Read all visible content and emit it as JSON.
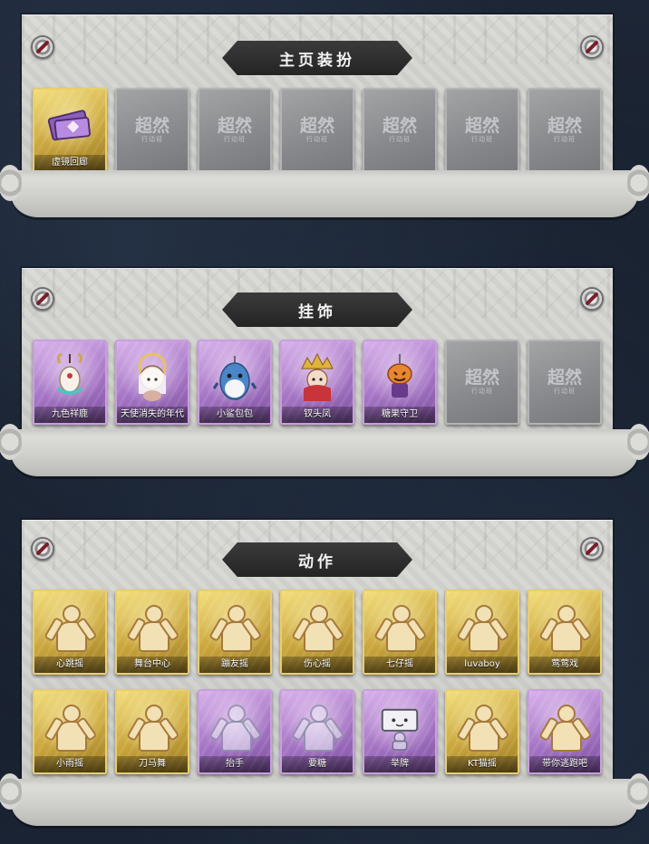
{
  "sections": [
    {
      "title": "主页装扮",
      "items": [
        {
          "label": "虚镜回廊",
          "rarity": "gold",
          "icon": "ticket-icon"
        },
        {
          "label": "",
          "rarity": "empty",
          "icon": "empty-slot-logo"
        },
        {
          "label": "",
          "rarity": "empty",
          "icon": "empty-slot-logo"
        },
        {
          "label": "",
          "rarity": "empty",
          "icon": "empty-slot-logo"
        },
        {
          "label": "",
          "rarity": "empty",
          "icon": "empty-slot-logo"
        },
        {
          "label": "",
          "rarity": "empty",
          "icon": "empty-slot-logo"
        },
        {
          "label": "",
          "rarity": "empty",
          "icon": "empty-slot-logo"
        }
      ]
    },
    {
      "title": "挂饰",
      "items": [
        {
          "label": "九色祥鹿",
          "rarity": "purple",
          "icon": "deer-charm-icon"
        },
        {
          "label": "天使消失的年代",
          "rarity": "purple",
          "icon": "angel-charm-icon"
        },
        {
          "label": "小鲨包包",
          "rarity": "purple",
          "icon": "shark-charm-icon"
        },
        {
          "label": "钗头凤",
          "rarity": "purple",
          "icon": "phoenix-charm-icon"
        },
        {
          "label": "糖果守卫",
          "rarity": "purple",
          "icon": "pumpkin-charm-icon"
        },
        {
          "label": "",
          "rarity": "empty",
          "icon": "empty-slot-logo"
        },
        {
          "label": "",
          "rarity": "empty",
          "icon": "empty-slot-logo"
        }
      ]
    },
    {
      "title": "动作",
      "items": [
        {
          "label": "心跳摇",
          "rarity": "gold",
          "icon": "dance-figure-icon"
        },
        {
          "label": "舞台中心",
          "rarity": "gold",
          "icon": "dance-figure-icon"
        },
        {
          "label": "蹦友摇",
          "rarity": "gold",
          "icon": "dance-figure-icon"
        },
        {
          "label": "伤心摇",
          "rarity": "gold",
          "icon": "dance-figure-icon"
        },
        {
          "label": "七仔摇",
          "rarity": "gold",
          "icon": "dance-figure-icon"
        },
        {
          "label": "luvaboy",
          "rarity": "gold",
          "icon": "dance-figure-icon"
        },
        {
          "label": "莺莺戏",
          "rarity": "gold",
          "icon": "dance-figure-icon"
        },
        {
          "label": "小雨摇",
          "rarity": "gold",
          "icon": "dance-figure-icon"
        },
        {
          "label": "刀马舞",
          "rarity": "gold",
          "icon": "dance-figure-icon"
        },
        {
          "label": "抬手",
          "rarity": "purple",
          "icon": "ghost-figure-icon"
        },
        {
          "label": "要糖",
          "rarity": "purple",
          "icon": "ghost-figure-icon"
        },
        {
          "label": "举牌",
          "rarity": "purple",
          "icon": "sign-figure-icon"
        },
        {
          "label": "KT猫摇",
          "rarity": "gold",
          "icon": "dance-figure-icon"
        },
        {
          "label": "带你逃跑吧",
          "rarity": "purple",
          "icon": "dance-figure-icon"
        }
      ]
    }
  ],
  "empty_slot": {
    "logo_text": "超然",
    "logo_sub": "行动班"
  }
}
